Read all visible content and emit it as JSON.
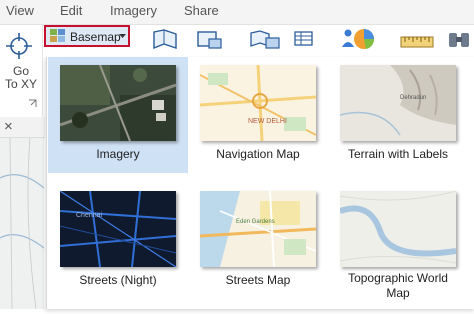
{
  "menu": {
    "view": "View",
    "edit": "Edit",
    "imagery": "Imagery",
    "share": "Share"
  },
  "ribbon": {
    "goto_xy_line1": "Go",
    "goto_xy_line2": "To XY",
    "basemap_label": "Basemap",
    "basemap_icon": "basemap-grid-icon",
    "dropdown_icon": "chevron-down-icon"
  },
  "pane": {
    "close_glyph": "×"
  },
  "gallery": {
    "items": [
      {
        "label": "Imagery",
        "selected": true,
        "thumb": "imagery"
      },
      {
        "label": "Navigation Map",
        "selected": false,
        "thumb": "navigation"
      },
      {
        "label": "Terrain with Labels",
        "selected": false,
        "thumb": "terrain"
      },
      {
        "label": "Streets (Night)",
        "selected": false,
        "thumb": "night"
      },
      {
        "label": "Streets Map",
        "selected": false,
        "thumb": "streets"
      },
      {
        "label": "Topographic World Map",
        "selected": false,
        "thumb": "topo"
      }
    ],
    "thumb_text": {
      "navigation_city": "NEW DELHI",
      "terrain_place": "Dehradun",
      "night_place": "Chennai",
      "streets_place": "Eden Gardens"
    }
  },
  "colors": {
    "highlight_border": "#c8102e",
    "selected_tile": "#cfe1f5"
  }
}
